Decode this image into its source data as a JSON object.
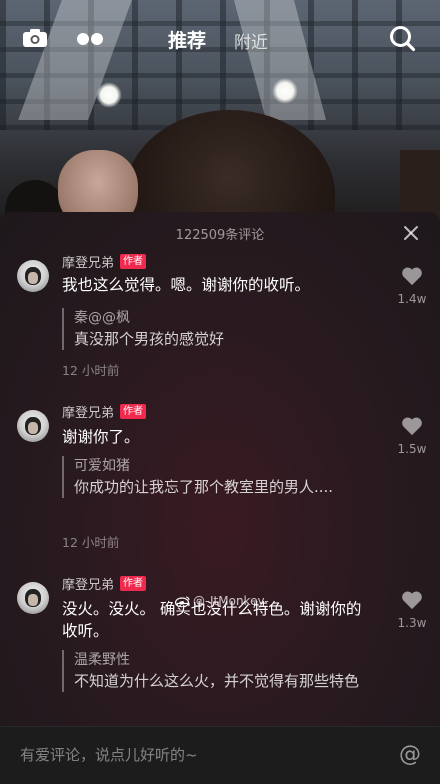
{
  "topbar": {
    "tab_recommended": "推荐",
    "tab_nearby": "附近",
    "camera_icon": "camera-icon",
    "mode_icon": "dots-icon",
    "search_icon": "search-icon"
  },
  "panel": {
    "count_label": "122509条评论",
    "close_icon": "close-icon"
  },
  "comments": [
    {
      "author": "摩登兄弟",
      "badge": "作者",
      "text": "我也这么觉得。嗯。谢谢你的收听。",
      "likes": "1.4w",
      "reply_user": "秦@@枫",
      "reply_text": "真没那个男孩的感觉好",
      "time": "12 小时前"
    },
    {
      "author": "摩登兄弟",
      "badge": "作者",
      "text": "谢谢你了。",
      "likes": "1.5w",
      "reply_user": "可爱如猪",
      "reply_text": "你成功的让我忘了那个教室里的男人....",
      "time": "12 小时前"
    },
    {
      "author": "摩登兄弟",
      "badge": "作者",
      "text": "没火。没火。 确实也没什么特色。谢谢你的收听。",
      "likes": "1.3w",
      "reply_user": "温柔野性",
      "reply_text": "不知道为什么这么火，并不觉得有那些特色"
    }
  ],
  "watermark": "@-JtMonkey-",
  "input": {
    "placeholder": "有爱评论，说点儿好听的~",
    "at_symbol": "@"
  },
  "colors": {
    "badge": "#f0294e",
    "panel_bg": "#2a1a20"
  }
}
